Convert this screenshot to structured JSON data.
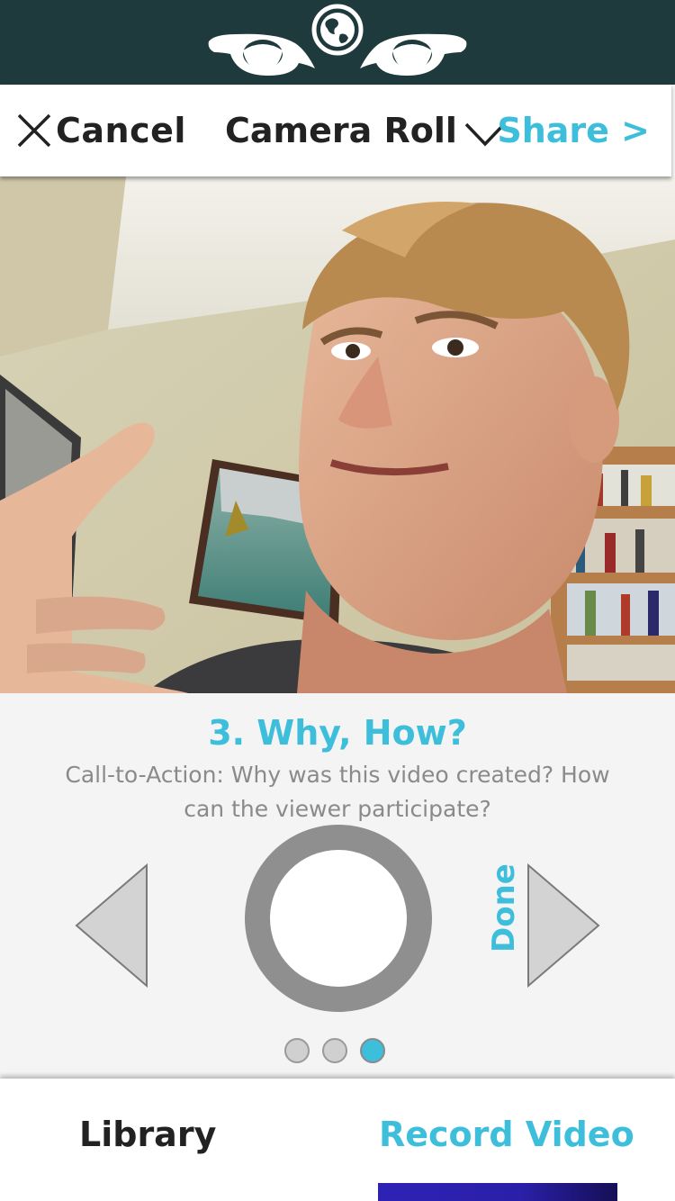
{
  "nav": {
    "cancel_label": "Cancel",
    "album_label": "Camera Roll",
    "share_label": "Share >"
  },
  "prompt": {
    "title": "3. Why, How?",
    "description": "Call-to-Action: Why was this video created? How can the viewer participate?",
    "done_label": "Done",
    "page_indicator": {
      "total": 3,
      "current": 3
    }
  },
  "tabs": [
    {
      "label": "Library",
      "active": false
    },
    {
      "label": "Record Video",
      "active": true
    }
  ],
  "colors": {
    "brand_bar": "#1e3a3d",
    "accent": "#3dbedb",
    "record_ring": "#8f8f8f",
    "tab_indicator": "#2e22b5"
  },
  "icons": [
    "globe-eyes-logo",
    "close-icon",
    "chevron-down-icon",
    "left-arrow-icon",
    "right-arrow-icon"
  ]
}
